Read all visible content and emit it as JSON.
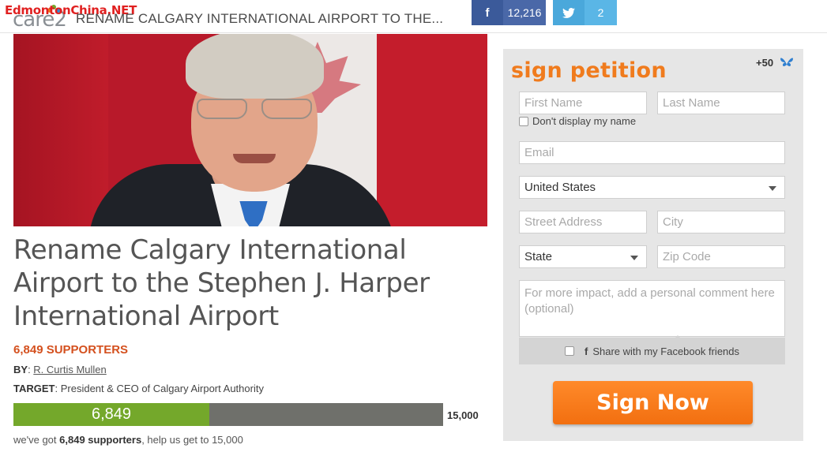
{
  "header": {
    "logo_text": "care2",
    "watermark": "EdmontonChina.NET",
    "title": "RENAME CALGARY INTERNATIONAL AIRPORT TO THE...",
    "facebook": {
      "icon": "facebook-icon",
      "count": "12,216",
      "color": "#4a68a8"
    },
    "twitter": {
      "icon": "twitter-icon",
      "count": "2",
      "color": "#5ab6e6"
    }
  },
  "petition": {
    "title": "Rename Calgary International Airport to the Stephen J. Harper International Airport",
    "supporters": "6,849 SUPPORTERS",
    "by_label": "BY",
    "author": "R. Curtis Mullen",
    "target_label": "TARGET",
    "target": "President & CEO of Calgary Airport Authority",
    "progress": {
      "current_label": "6,849",
      "goal_label": "15,000",
      "fraction": 0.4566
    },
    "help_text_prefix": "we've got ",
    "help_text_bold": "6,849 supporters",
    "help_text_suffix": ", help us get to 15,000"
  },
  "sign_form": {
    "title": "sign petition",
    "bonus": "+50",
    "bonus_icon": "butterfly-icon",
    "first_name_placeholder": "First Name",
    "last_name_placeholder": "Last Name",
    "hide_name_label": "Don't display my name",
    "email_placeholder": "Email",
    "country_value": "United States",
    "street_placeholder": "Street Address",
    "city_placeholder": "City",
    "state_value": "State",
    "zip_placeholder": "Zip Code",
    "comment_placeholder": "For more impact, add a personal comment here (optional)",
    "share_label": "Share with my Facebook friends",
    "submit_label": "Sign Now",
    "accent_color": "#f07b1d"
  }
}
